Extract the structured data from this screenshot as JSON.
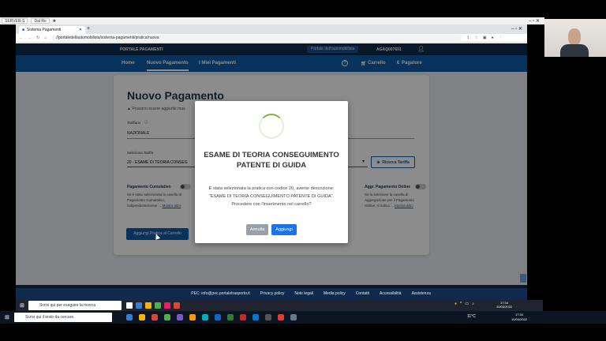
{
  "remote": {
    "tab1": "SERVER-S",
    "tab2": "Dal Re",
    "tab_plus": "✚",
    "window_controls": "–  ▫  ✕"
  },
  "browser": {
    "tab_title": "Sistema Pagamenti",
    "new_tab": "+",
    "window_controls": "–  ▫  ✕",
    "url": "//portaledellautomobilista/sistema-pagamenti/pratica/nuova",
    "nav": {
      "back": "←",
      "forward": "→",
      "reload": "↻",
      "home": "⌂"
    }
  },
  "site": {
    "brand": "PORTALE PAGAMENTI",
    "portal_link": "Portale dell'automobilista",
    "user_code": "AGAQ007601",
    "nav": {
      "home": "Home",
      "new_payment": "Nuovo Pagamento",
      "my_payments": "I Miei Pagamenti",
      "cart": "Carrello",
      "pay": "Pagatore"
    }
  },
  "page": {
    "title": "Nuovo Pagamento",
    "warning": "Possono essere aggiunte max",
    "tariff_label": "Tariffario",
    "tariff_value": "NAZIONALE",
    "select_label": "Seleziona Tariffa",
    "select_value": "20 - ESAME DI TEORIA CONSEG",
    "search_button": "Ricerca Tariffa",
    "cumulative_title": "Pagamento Cumulativo",
    "cumulative_desc_1": "Se è stato selezionata la casella di",
    "cumulative_desc_2": "Pagamento Cumulativo,",
    "cumulative_desc_3": "indipendentemente ...",
    "show_more": "Mostra altro",
    "online_title": "Aggr. Pagamento Online",
    "online_desc_1": "Se la selezione la casella di",
    "online_desc_2": "Aggregazione per il Pagamento",
    "online_desc_3": "Online, si indica ...",
    "add_to_cart": "Aggiungi Pratica al Carrello"
  },
  "footer": {
    "links": [
      "PEC: info@pec.portaletrasporto.it",
      "Privacy policy",
      "Note legali",
      "Media policy",
      "Contatti",
      "Accessibilità",
      "Assistenza"
    ]
  },
  "modal": {
    "title": "ESAME DI TEORIA CONSEGUIMENTO PATENTE DI GUIDA",
    "message": "È stata selezionata la pratica con codice 20, avente descrizione: \"ESAME DI TEORIA CONSEGUIMENTO PATENTE DI GUIDA\".",
    "question": "Procedere con l'inserimento nel carrello?",
    "cancel": "Annulla",
    "confirm": "Aggiungi",
    "colors": {
      "primary": "#1a73e8",
      "cancel": "#9aa0a6",
      "spinner": "#7fb34a"
    }
  },
  "remote_taskbar": {
    "search_placeholder": "Scrivi qui per eseguire la ricerca",
    "time": "17:34",
    "date": "10/03/2022"
  },
  "local_taskbar": {
    "search_placeholder": "Scrivi qui il testo da cercare.",
    "weather": "11°C",
    "time": "17:34",
    "date": "10/03/2022"
  }
}
